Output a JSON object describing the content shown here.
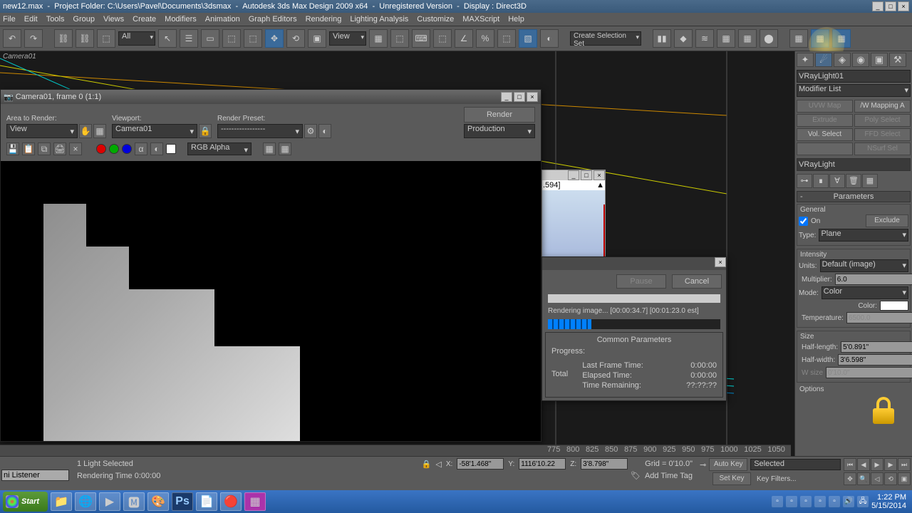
{
  "title": {
    "filename": "new12.max",
    "project": "Project Folder: C:\\Users\\Pavel\\Documents\\3dsmax",
    "app": "Autodesk 3ds Max Design 2009 x64",
    "reg": "Unregistered Version",
    "display": "Display : Direct3D"
  },
  "menu": [
    "File",
    "Edit",
    "Tools",
    "Group",
    "Views",
    "Create",
    "Modifiers",
    "Animation",
    "Graph Editors",
    "Rendering",
    "Lighting Analysis",
    "Customize",
    "MAXScript",
    "Help"
  ],
  "toolbar": {
    "filter": "All",
    "view": "View",
    "selection_set": "Create Selection Set"
  },
  "viewport": {
    "label": "Camera01"
  },
  "render_window": {
    "title": "Camera01, frame 0 (1:1)",
    "area_label": "Area to Render:",
    "area_value": "View",
    "viewport_label": "Viewport:",
    "viewport_value": "Camera01",
    "preset_label": "Render Preset:",
    "preset_value": "-----------------",
    "render_btn": "Render",
    "mode": "Production",
    "channel": "RGB Alpha"
  },
  "sub_window": {
    "value": ".594]"
  },
  "progress": {
    "pause": "Pause",
    "cancel": "Cancel",
    "status": "Rendering image... [00:00:34.7] [00:01:23.0 est]",
    "group": "Common Parameters",
    "progress_label": "Progress:",
    "total": "Total",
    "last_frame": "Last Frame Time:",
    "last_frame_v": "0:00:00",
    "elapsed": "Elapsed Time:",
    "elapsed_v": "0:00:00",
    "remaining": "Time Remaining:",
    "remaining_v": "??:??:??"
  },
  "command_panel": {
    "object_name": "VRayLight01",
    "modifier_list": "Modifier List",
    "btns": [
      "UVW Map",
      "/W Mapping A",
      "Extrude",
      "Poly Select",
      "Vol. Select",
      "FFD Select",
      "",
      "NSurf Sel"
    ],
    "stack": "VRayLight",
    "rollout1": "Parameters",
    "general": "General",
    "on": "On",
    "exclude": "Exclude",
    "type_label": "Type:",
    "type_value": "Plane",
    "intensity": "Intensity",
    "units_label": "Units:",
    "units_value": "Default (image)",
    "multiplier_label": "Multiplier:",
    "multiplier_value": "6.0",
    "mode_label": "Mode:",
    "mode_value": "Color",
    "color_label": "Color:",
    "temp_label": "Temperature:",
    "temp_value": "6500.0",
    "size": "Size",
    "half_length_label": "Half-length:",
    "half_length_value": "5'0.891\"",
    "half_width_label": "Half-width:",
    "half_width_value": "3'6.598\"",
    "wsize_label": "W size",
    "wsize_value": "0'10.0\"",
    "options": "Options"
  },
  "time_ticks": [
    "775",
    "800",
    "825",
    "850",
    "875",
    "900",
    "925",
    "950",
    "975",
    "1000",
    "1025",
    "1050"
  ],
  "status": {
    "listener": "ni Listener",
    "selection": "1 Light Selected",
    "render_time": "Rendering Time 0:00:00",
    "x": "-58'1.468\"",
    "y": "1116'10.22",
    "z": "3'8.798\"",
    "grid": "Grid = 0'10.0\"",
    "add_time_tag": "Add Time Tag",
    "auto_key": "Auto Key",
    "set_key": "Set Key",
    "selected": "Selected",
    "key_filters": "Key Filters..."
  },
  "taskbar": {
    "start": "Start",
    "time": "1:22 PM",
    "date": "5/15/2014"
  }
}
